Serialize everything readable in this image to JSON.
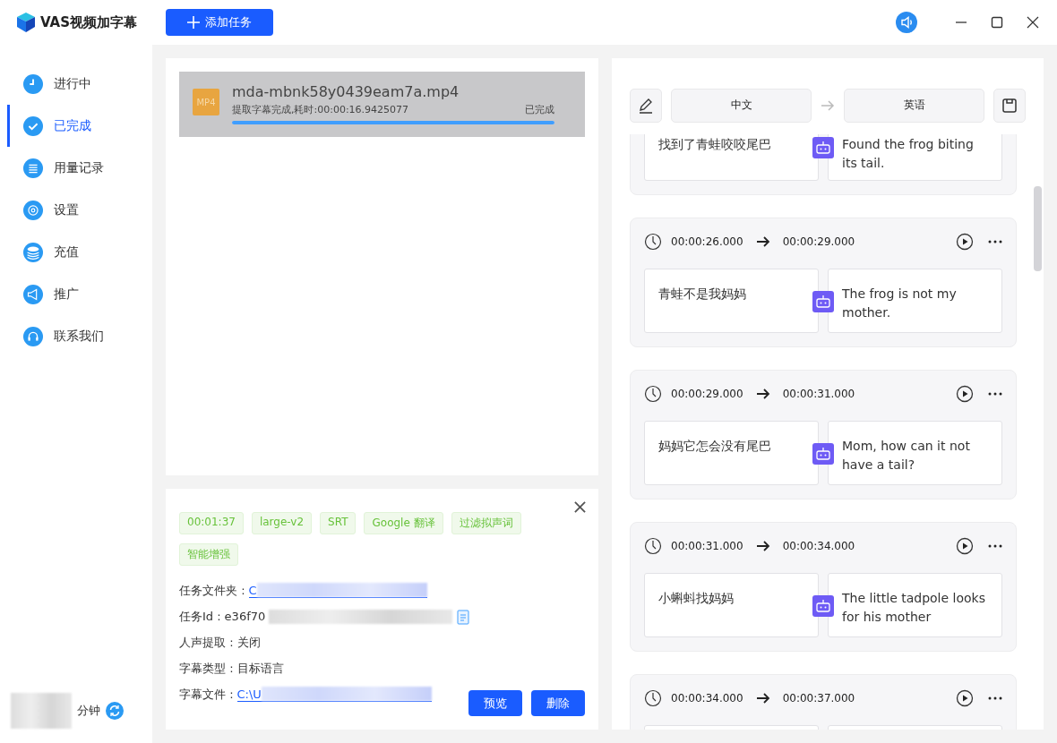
{
  "app": {
    "title": "VAS视频加字幕",
    "add_button": "添加任务"
  },
  "sidebar": {
    "items": [
      {
        "label": "进行中",
        "selected": false
      },
      {
        "label": "已完成",
        "selected": true
      },
      {
        "label": "用量记录",
        "selected": false
      },
      {
        "label": "设置",
        "selected": false
      },
      {
        "label": "充值",
        "selected": false
      },
      {
        "label": "推广",
        "selected": false
      },
      {
        "label": "联系我们",
        "selected": false
      }
    ],
    "balance_unit": "分钟"
  },
  "tasks": [
    {
      "file_name": "mda-mbnk58y0439eam7a.mp4",
      "badge": "MP4",
      "status_text": "提取字幕完成,耗时:00:00:16.9425077",
      "state": "已完成",
      "level": 1,
      "selected": true
    }
  ],
  "details": {
    "tags": [
      "00:01:37",
      "large-v2",
      "SRT",
      "Google 翻译",
      "过滤拟声词",
      "智能增强"
    ],
    "rows": [
      {
        "label": "任务文件夹 :",
        "value": "C",
        "kind": "link"
      },
      {
        "label": "任务Id :",
        "value": "e36f70",
        "kind": "copy"
      },
      {
        "label": "人声提取 :",
        "value": "关闭",
        "kind": "text"
      },
      {
        "label": "字幕类型 :",
        "value": "目标语言",
        "kind": "text"
      },
      {
        "label": "字幕文件 :",
        "value": "C:\\U",
        "kind": "link"
      }
    ],
    "buttons": [
      "预览",
      "删除"
    ]
  },
  "editor": {
    "source_lang": "中文",
    "target_lang": "英语",
    "segments": [
      {
        "source": "找到了青蛙咬咬尾巴",
        "target": "Found the frog biting its tail."
      },
      {
        "start": "00:00:26.000",
        "end": "00:00:29.000",
        "source": "青蛙不是我妈妈",
        "target": "The frog is not my mother."
      },
      {
        "start": "00:00:29.000",
        "end": "00:00:31.000",
        "source": "妈妈它怎会没有尾巴",
        "target": "Mom, how can it not have a tail?"
      },
      {
        "start": "00:00:31.000",
        "end": "00:00:34.000",
        "source": "小蝌蚪找妈妈",
        "target": "The little tadpole looks for his mother"
      },
      {
        "start": "00:00:34.000",
        "end": "00:00:37.000"
      }
    ]
  }
}
